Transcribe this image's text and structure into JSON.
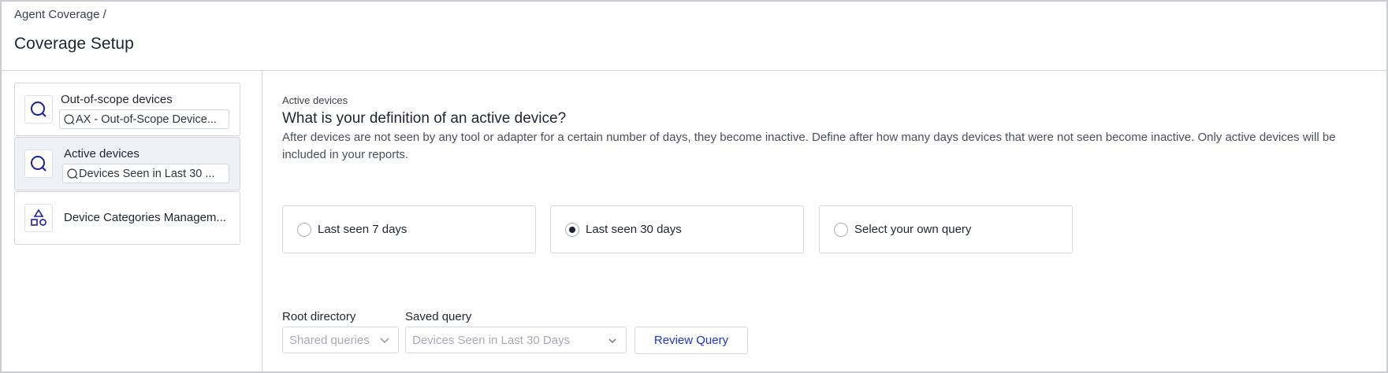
{
  "header": {
    "breadcrumb": "Agent Coverage /",
    "title": "Coverage Setup"
  },
  "sidebar": {
    "items": [
      {
        "title": "Out-of-scope devices",
        "query": "AX - Out-of-Scope Device...",
        "icon": "query-icon"
      },
      {
        "title": "Active devices",
        "query": "Devices Seen in Last 30 ...",
        "icon": "query-icon",
        "active": true
      },
      {
        "title": "Device Categories Managem...",
        "icon": "shapes-icon"
      }
    ]
  },
  "main": {
    "section_label": "Active devices",
    "question": "What is your definition of an active device?",
    "description": "After devices are not seen by any tool or adapter for a certain number of days, they become inactive. Define after how many days devices that were not seen become inactive. Only active devices will be included in your reports.",
    "options": [
      {
        "label": "Last seen 7 days",
        "selected": false
      },
      {
        "label": "Last seen 30 days",
        "selected": true
      },
      {
        "label": "Select your own query",
        "selected": false
      }
    ],
    "root_directory": {
      "label": "Root directory",
      "value": "Shared queries"
    },
    "saved_query": {
      "label": "Saved query",
      "value": "Devices Seen in Last 30 Days"
    },
    "review_button": "Review Query"
  },
  "colors": {
    "accent": "#1a33d8",
    "icon": "#1a1fa8",
    "active_card_bg": "#eff1f7",
    "border": "#d3d6dc"
  }
}
